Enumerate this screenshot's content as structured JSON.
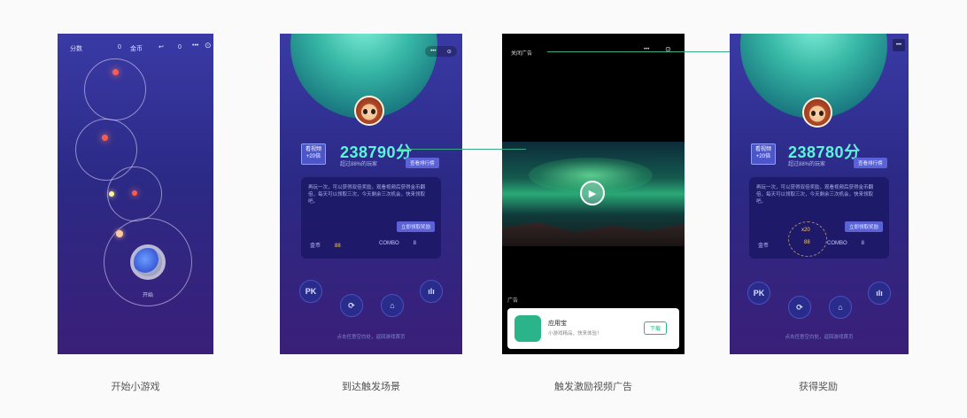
{
  "captions": [
    "开始小游戏",
    "到达触发场景",
    "触发激励视频广告",
    "获得奖励"
  ],
  "screen1": {
    "topbar_left": "分数",
    "topbar_val1": "0",
    "topbar_label2": "金币",
    "topbar_val2": "0",
    "ball_label": "开始"
  },
  "screen2": {
    "score": "238790分",
    "score_sub": "超过88%的玩家",
    "badge": "看视频 +20倍",
    "share_pill": "查看排行榜",
    "card_text": "再玩一次，可以获得双倍奖励，观看视频后获得金币翻倍，每天可以领取三次，今天剩余三次机会，快来领取吧。",
    "card_pill": "立即领取奖励",
    "stat_coin_label": "金币",
    "stat_coin_val": "88",
    "stat_combo_label": "COMBO",
    "stat_combo_val": "8",
    "buttons": [
      "PK",
      "⟳",
      "⌂",
      "ılı"
    ],
    "hint": "点击任意空白处，返回游戏首页"
  },
  "screen3": {
    "skip_text": "关闭广告",
    "ad_label": "广告",
    "app_name": "应用宝",
    "app_desc": "小游戏精品，快来体验！",
    "download": "下载"
  },
  "screen4": {
    "score": "238780分",
    "score_sub": "超过88%的玩家",
    "badge": "看视频 +20倍",
    "share_pill": "查看排行榜",
    "card_text": "再玩一次，可以获得双倍奖励，观看视频后获得金币翻倍，每天可以领取三次，今天剩余三次机会，快来领取吧。",
    "card_pill": "立即领取奖励",
    "stat_coin_label": "金币",
    "reward_top": "x20",
    "reward_val": "88",
    "stat_combo_label": "COMBO",
    "stat_combo_val": "8",
    "buttons": [
      "PK",
      "⟳",
      "⌂",
      "ılı"
    ],
    "hint": "点击任意空白处，返回游戏首页"
  },
  "colors": {
    "accent_green": "#5ff3d9",
    "connector": "#3ba986",
    "bg_purple": "#2b2a86"
  }
}
